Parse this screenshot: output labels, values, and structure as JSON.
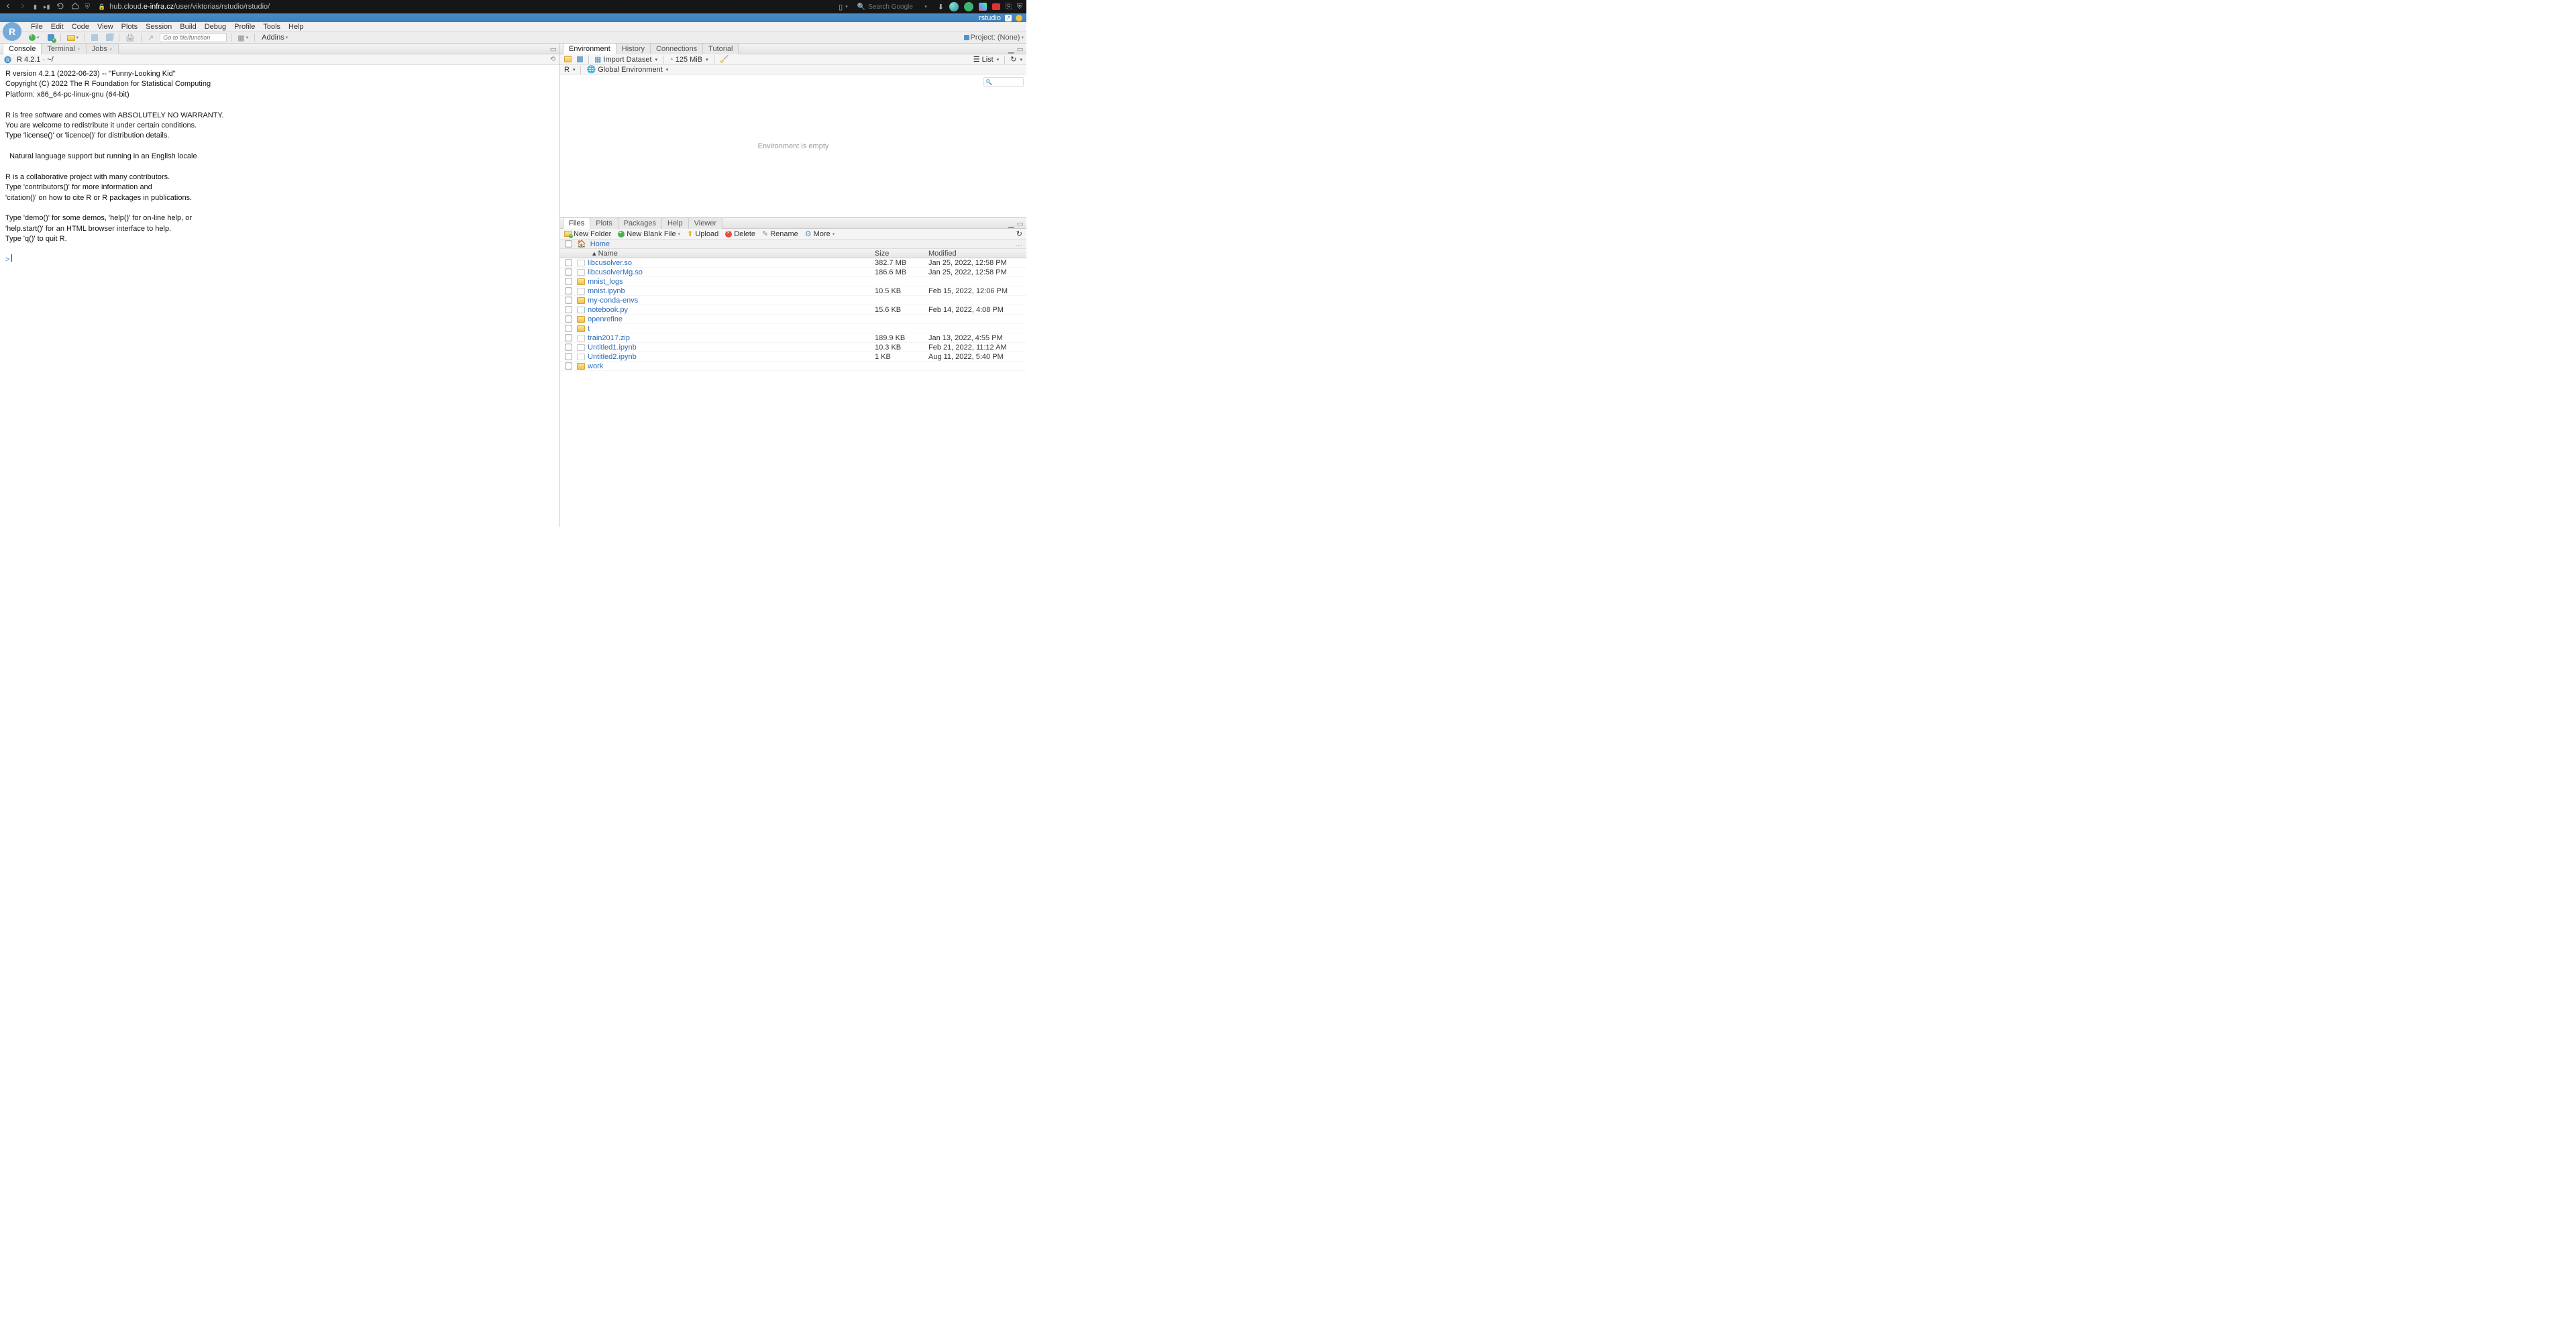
{
  "browser": {
    "url_pre": "hub.cloud.",
    "url_host": "e-infra.cz",
    "url_path": "/user/viktorias/rstudio/rstudio/",
    "search_placeholder": "Search Google"
  },
  "header": {
    "app_name": "rstudio"
  },
  "menu": {
    "items": [
      "File",
      "Edit",
      "Code",
      "View",
      "Plots",
      "Session",
      "Build",
      "Debug",
      "Profile",
      "Tools",
      "Help"
    ]
  },
  "toolbar": {
    "goto_placeholder": "Go to file/function",
    "addins": "Addins",
    "project": "Project: (None)"
  },
  "console": {
    "tabs": [
      "Console",
      "Terminal",
      "Jobs"
    ],
    "subtitle": "R 4.2.1 · ~/",
    "banner": "R version 4.2.1 (2022-06-23) -- \"Funny-Looking Kid\"\nCopyright (C) 2022 The R Foundation for Statistical Computing\nPlatform: x86_64-pc-linux-gnu (64-bit)\n\nR is free software and comes with ABSOLUTELY NO WARRANTY.\nYou are welcome to redistribute it under certain conditions.\nType 'license()' or 'licence()' for distribution details.\n\n  Natural language support but running in an English locale\n\nR is a collaborative project with many contributors.\nType 'contributors()' for more information and\n'citation()' on how to cite R or R packages in publications.\n\nType 'demo()' for some demos, 'help()' for on-line help, or\n'help.start()' for an HTML browser interface to help.\nType 'q()' to quit R.\n",
    "prompt": "> "
  },
  "env": {
    "tabs": [
      "Environment",
      "History",
      "Connections",
      "Tutorial"
    ],
    "import": "Import Dataset",
    "mem": "125 MiB",
    "list": "List",
    "lang": "R",
    "scope": "Global Environment",
    "empty": "Environment is empty"
  },
  "files": {
    "tabs": [
      "Files",
      "Plots",
      "Packages",
      "Help",
      "Viewer"
    ],
    "new_folder": "New Folder",
    "new_file": "New Blank File",
    "upload": "Upload",
    "delete": "Delete",
    "rename": "Rename",
    "more": "More",
    "home": "Home",
    "cols": {
      "name": "Name",
      "size": "Size",
      "mod": "Modified"
    },
    "rows": [
      {
        "type": "file",
        "name": "libcusolver.so",
        "size": "382.7 MB",
        "mod": "Jan 25, 2022, 12:58 PM"
      },
      {
        "type": "file",
        "name": "libcusolverMg.so",
        "size": "186.6 MB",
        "mod": "Jan 25, 2022, 12:58 PM"
      },
      {
        "type": "folder",
        "name": "mnist_logs",
        "size": "",
        "mod": ""
      },
      {
        "type": "file",
        "name": "mnist.ipynb",
        "size": "10.5 KB",
        "mod": "Feb 15, 2022, 12:06 PM"
      },
      {
        "type": "folder",
        "name": "my-conda-envs",
        "size": "",
        "mod": ""
      },
      {
        "type": "code",
        "name": "notebook.py",
        "size": "15.6 KB",
        "mod": "Feb 14, 2022, 4:08 PM"
      },
      {
        "type": "folder",
        "name": "openrefine",
        "size": "",
        "mod": ""
      },
      {
        "type": "folder",
        "name": "t",
        "size": "",
        "mod": ""
      },
      {
        "type": "file",
        "name": "train2017.zip",
        "size": "189.9 KB",
        "mod": "Jan 13, 2022, 4:55 PM"
      },
      {
        "type": "file",
        "name": "Untitled1.ipynb",
        "size": "10.3 KB",
        "mod": "Feb 21, 2022, 11:12 AM"
      },
      {
        "type": "file",
        "name": "Untitled2.ipynb",
        "size": "1 KB",
        "mod": "Aug 11, 2022, 5:40 PM"
      },
      {
        "type": "folder",
        "name": "work",
        "size": "",
        "mod": ""
      }
    ]
  }
}
